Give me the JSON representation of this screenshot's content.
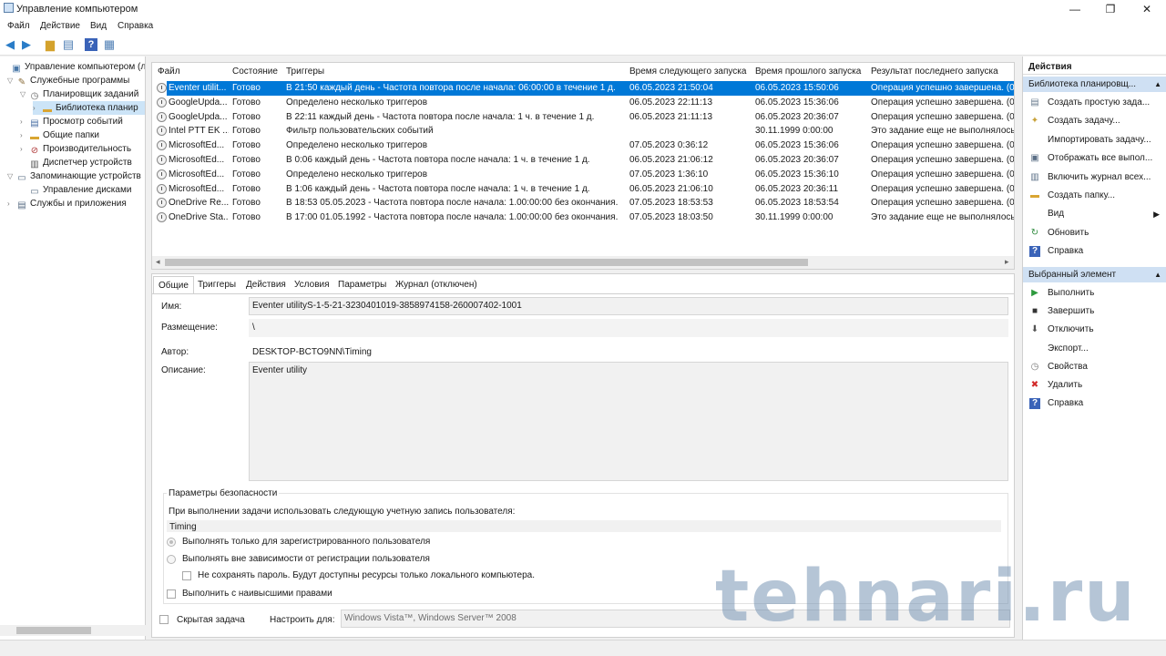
{
  "window": {
    "title": "Управление компьютером",
    "controls": {
      "minimize": "—",
      "restore": "❐",
      "close": "✕"
    }
  },
  "menu": [
    "Файл",
    "Действие",
    "Вид",
    "Справка"
  ],
  "toolbar_icons": [
    "back-icon",
    "forward-icon",
    "up-folder-icon",
    "show-pane-icon",
    "help-icon",
    "properties-icon"
  ],
  "tree": [
    {
      "label": "Управление компьютером (лс",
      "icon": "computer-icon"
    },
    {
      "label": "Служебные программы",
      "icon": "tools-icon"
    },
    {
      "label": "Планировщик заданий",
      "icon": "clock-icon"
    },
    {
      "label": "Библиотека планир",
      "icon": "folder-icon"
    },
    {
      "label": "Просмотр событий",
      "icon": "event-viewer-icon"
    },
    {
      "label": "Общие папки",
      "icon": "shared-folder-icon"
    },
    {
      "label": "Производительность",
      "icon": "performance-icon"
    },
    {
      "label": "Диспетчер устройств",
      "icon": "device-manager-icon"
    },
    {
      "label": "Запоминающие устройств",
      "icon": "storage-icon"
    },
    {
      "label": "Управление дисками",
      "icon": "disk-icon"
    },
    {
      "label": "Службы и приложения",
      "icon": "services-icon"
    }
  ],
  "tasks": {
    "columns": [
      "Файл",
      "Состояние",
      "Триггеры",
      "Время следующего запуска",
      "Время прошлого запуска",
      "Результат последнего запуска"
    ],
    "rows": [
      {
        "name": "Eventer utilit...",
        "state": "Готово",
        "trigger": "В 21:50 каждый день - Частота повтора после начала: 06:00:00 в течение 1 д.",
        "next": "06.05.2023 21:50:04",
        "last": "06.05.2023 15:50:06",
        "result": "Операция успешно завершена. (0x0"
      },
      {
        "name": "GoogleUpda...",
        "state": "Готово",
        "trigger": "Определено несколько триггеров",
        "next": "06.05.2023 22:11:13",
        "last": "06.05.2023 15:36:06",
        "result": "Операция успешно завершена. (0x0"
      },
      {
        "name": "GoogleUpda...",
        "state": "Готово",
        "trigger": "В 22:11 каждый день - Частота повтора после начала: 1 ч. в течение 1 д.",
        "next": "06.05.2023 21:11:13",
        "last": "06.05.2023 20:36:07",
        "result": "Операция успешно завершена. (0x0"
      },
      {
        "name": "Intel PTT EK ...",
        "state": "Готово",
        "trigger": "Фильтр пользовательских событий",
        "next": "",
        "last": "30.11.1999 0:00:00",
        "result": "Это задание еще не выполнялось. (0"
      },
      {
        "name": "MicrosoftEd...",
        "state": "Готово",
        "trigger": "Определено несколько триггеров",
        "next": "07.05.2023 0:36:12",
        "last": "06.05.2023 15:36:06",
        "result": "Операция успешно завершена. (0x0"
      },
      {
        "name": "MicrosoftEd...",
        "state": "Готово",
        "trigger": "В 0:06 каждый день - Частота повтора после начала: 1 ч. в течение 1 д.",
        "next": "06.05.2023 21:06:12",
        "last": "06.05.2023 20:36:07",
        "result": "Операция успешно завершена. (0x0"
      },
      {
        "name": "MicrosoftEd...",
        "state": "Готово",
        "trigger": "Определено несколько триггеров",
        "next": "07.05.2023 1:36:10",
        "last": "06.05.2023 15:36:10",
        "result": "Операция успешно завершена. (0x0"
      },
      {
        "name": "MicrosoftEd...",
        "state": "Готово",
        "trigger": "В 1:06 каждый день - Частота повтора после начала: 1 ч. в течение 1 д.",
        "next": "06.05.2023 21:06:10",
        "last": "06.05.2023 20:36:11",
        "result": "Операция успешно завершена. (0x0"
      },
      {
        "name": "OneDrive Re...",
        "state": "Готово",
        "trigger": "В 18:53 05.05.2023 - Частота повтора после начала: 1.00:00:00 без окончания.",
        "next": "07.05.2023 18:53:53",
        "last": "06.05.2023 18:53:54",
        "result": "Операция успешно завершена. (0x0"
      },
      {
        "name": "OneDrive Sta...",
        "state": "Готово",
        "trigger": "В 17:00 01.05.1992 - Частота повтора после начала: 1.00:00:00 без окончания.",
        "next": "07.05.2023 18:03:50",
        "last": "30.11.1999 0:00:00",
        "result": "Это задание еще не выполнялось. (0"
      }
    ]
  },
  "details": {
    "tabs": [
      "Общие",
      "Триггеры",
      "Действия",
      "Условия",
      "Параметры",
      "Журнал (отключен)"
    ],
    "name_label": "Имя:",
    "name_value": "Eventer utilityS-1-5-21-3230401019-3858974158-260007402-1001",
    "location_label": "Размещение:",
    "location_value": "\\",
    "author_label": "Автор:",
    "author_value": "DESKTOP-BCTO9NN\\Timing",
    "description_label": "Описание:",
    "description_value": "Eventer utility",
    "security": {
      "title": "Параметры безопасности",
      "account_prompt": "При выполнении задачи использовать следующую учетную запись пользователя:",
      "account": "Timing",
      "radio_logged_on": "Выполнять только для зарегистрированного пользователя",
      "radio_any": "Выполнять вне зависимости от регистрации пользователя",
      "no_store_password": "Не сохранять пароль. Будут доступны ресурсы только локального компьютера.",
      "highest_privileges": "Выполнить с наивысшими правами"
    },
    "hidden_label": "Скрытая задача",
    "configure_label": "Настроить для:",
    "configure_value": "Windows Vista™, Windows Server™ 2008"
  },
  "actions": {
    "header": "Действия",
    "library_section": "Библиотека планировщ...",
    "library_items": [
      {
        "label": "Создать простую зада...",
        "icon": "create-basic-task-icon"
      },
      {
        "label": "Создать задачу...",
        "icon": "create-task-icon"
      },
      {
        "label": "Импортировать задачу...",
        "icon": ""
      },
      {
        "label": "Отображать все выпол...",
        "icon": "running-tasks-icon"
      },
      {
        "label": "Включить журнал всех...",
        "icon": "history-icon"
      },
      {
        "label": "Создать папку...",
        "icon": "new-folder-icon"
      },
      {
        "label": "Вид",
        "icon": ""
      },
      {
        "label": "Обновить",
        "icon": "refresh-icon"
      },
      {
        "label": "Справка",
        "icon": "help-icon"
      }
    ],
    "selected_section": "Выбранный элемент",
    "selected_items": [
      {
        "label": "Выполнить",
        "icon": "run-icon"
      },
      {
        "label": "Завершить",
        "icon": "end-icon"
      },
      {
        "label": "Отключить",
        "icon": "disable-icon"
      },
      {
        "label": "Экспорт...",
        "icon": ""
      },
      {
        "label": "Свойства",
        "icon": "properties-icon"
      },
      {
        "label": "Удалить",
        "icon": "delete-icon"
      },
      {
        "label": "Справка",
        "icon": "help-icon"
      }
    ]
  },
  "watermark": "tehnari.ru",
  "colors": {
    "selection": "#0078d7",
    "section_header": "#cfe0f3",
    "tree_selection": "#cce4f7"
  }
}
